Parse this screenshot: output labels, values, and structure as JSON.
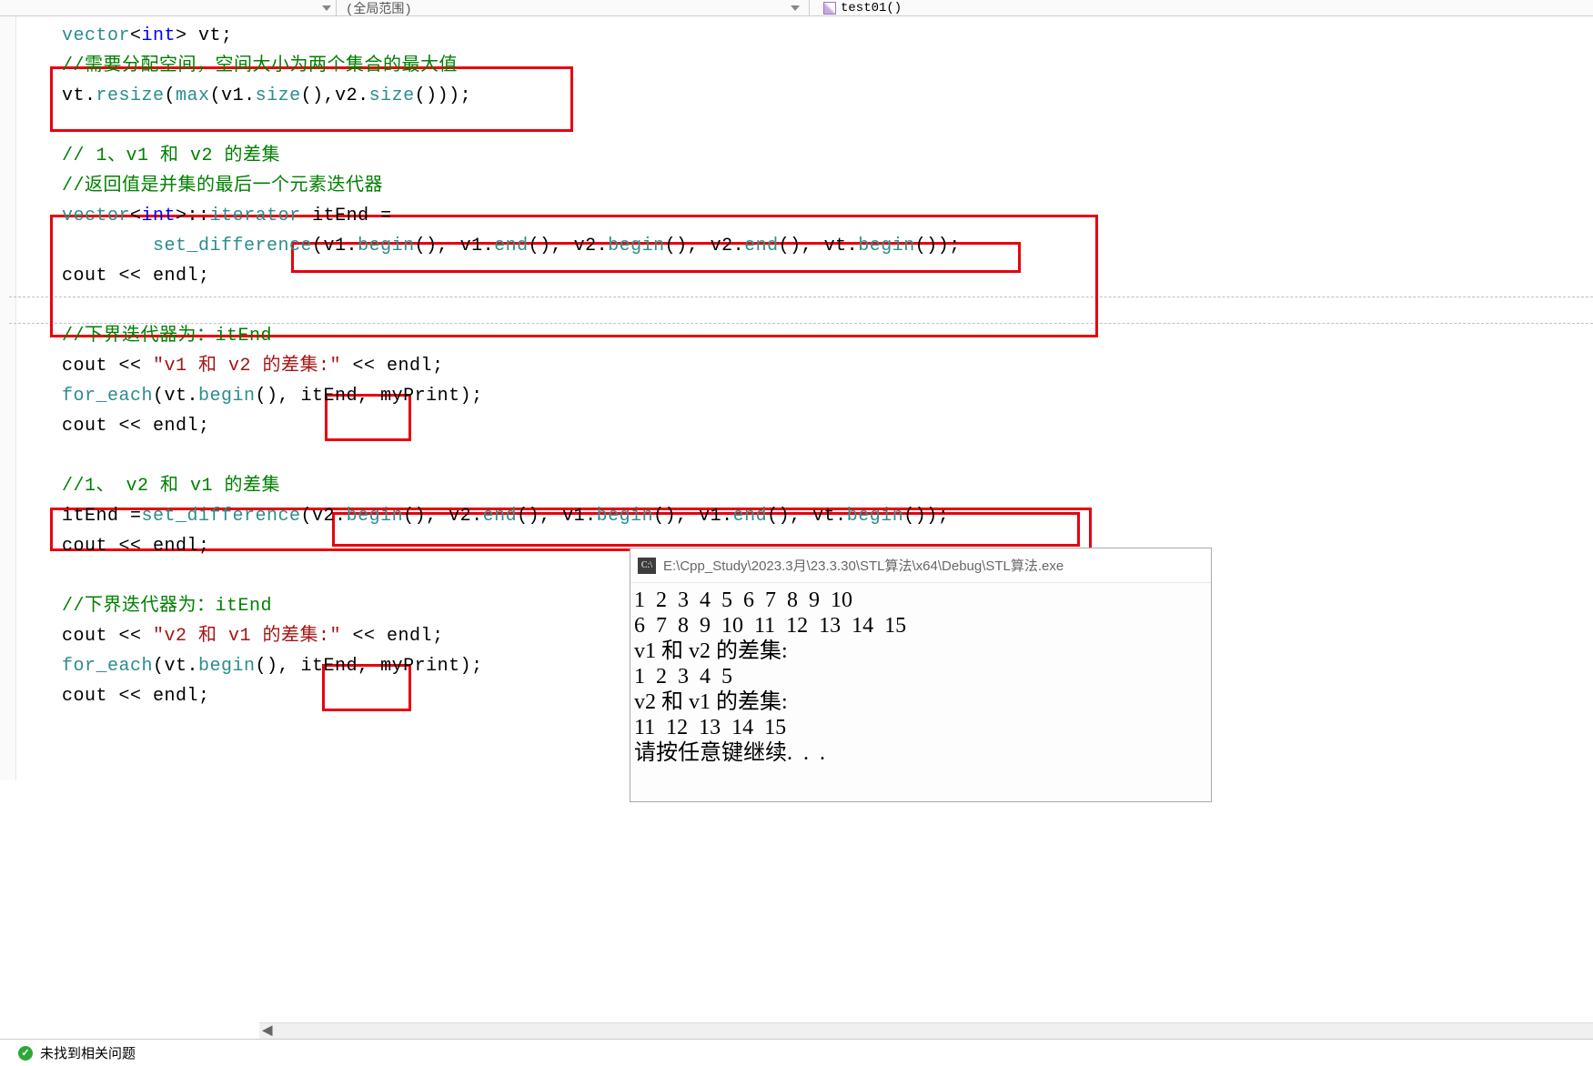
{
  "topbar": {
    "scope_label": "(全局范围)",
    "function_name": "test01()"
  },
  "code": {
    "l1_a": "vector",
    "l1_b": "<",
    "l1_c": "int",
    "l1_d": "> vt;",
    "l2": "//需要分配空间，空间大小为两个集合的最大值",
    "l3_a": "vt.",
    "l3_b": "resize",
    "l3_c": "(",
    "l3_d": "max",
    "l3_e": "(v1.",
    "l3_f": "size",
    "l3_g": "(),v2.",
    "l3_h": "size",
    "l3_i": "()));",
    "l5": "// 1、v1 和 v2 的差集",
    "l6": "//返回值是并集的最后一个元素迭代器",
    "l7_a": "vector",
    "l7_b": "<",
    "l7_c": "int",
    "l7_d": ">::",
    "l7_e": "iterator",
    "l7_f": " itEnd =",
    "l8_a": "        ",
    "l8_b": "set_difference",
    "l8_c": "(v1.",
    "l8_d": "begin",
    "l8_e": "(), v1.",
    "l8_f": "end",
    "l8_g": "(), v2.",
    "l8_h": "begin",
    "l8_i": "(), v2.",
    "l8_j": "end",
    "l8_k": "(), vt.",
    "l8_l": "begin",
    "l8_m": "());",
    "l9_a": "cout << endl;",
    "l11": "//下界迭代器为：itEnd",
    "l12_a": "cout << ",
    "l12_b": "\"v1 和 v2 的差集:\"",
    "l12_c": " << endl;",
    "l13_a": "for_each",
    "l13_b": "(vt.",
    "l13_c": "begin",
    "l13_d": "(), itEnd, myPrint);",
    "l14_a": "cout << endl;",
    "l16": "//1、 v2 和 v1 的差集",
    "l17_a": "itEnd =",
    "l17_b": "set_difference",
    "l17_c": "(v2.",
    "l17_d": "begin",
    "l17_e": "(), v2.",
    "l17_f": "end",
    "l17_g": "(), v1.",
    "l17_h": "begin",
    "l17_i": "(), v1.",
    "l17_j": "end",
    "l17_k": "(), vt.",
    "l17_l": "begin",
    "l17_m": "());",
    "l18_a": "cout << endl;",
    "l20": "//下界迭代器为：itEnd",
    "l21_a": "cout << ",
    "l21_b": "\"v2 和 v1 的差集:\"",
    "l21_c": " << endl;",
    "l22_a": "for_each",
    "l22_b": "(vt.",
    "l22_c": "begin",
    "l22_d": "(), itEnd, myPrint);",
    "l23_a": "cout << endl;"
  },
  "console": {
    "icon_text": "C:\\",
    "path": "E:\\Cpp_Study\\2023.3月\\23.3.30\\STL算法\\x64\\Debug\\STL算法.exe",
    "line1": "1  2  3  4  5  6  7  8  9  10",
    "line2": "6  7  8  9  10  11  12  13  14  15",
    "line3": "",
    "line4": "v1 和 v2 的差集:",
    "line5": "1  2  3  4  5",
    "line6": "",
    "line7": "v2 和 v1 的差集:",
    "line8": "11  12  13  14  15",
    "line9": "请按任意键继续.  .  ."
  },
  "status": {
    "message": "未找到相关问题"
  }
}
